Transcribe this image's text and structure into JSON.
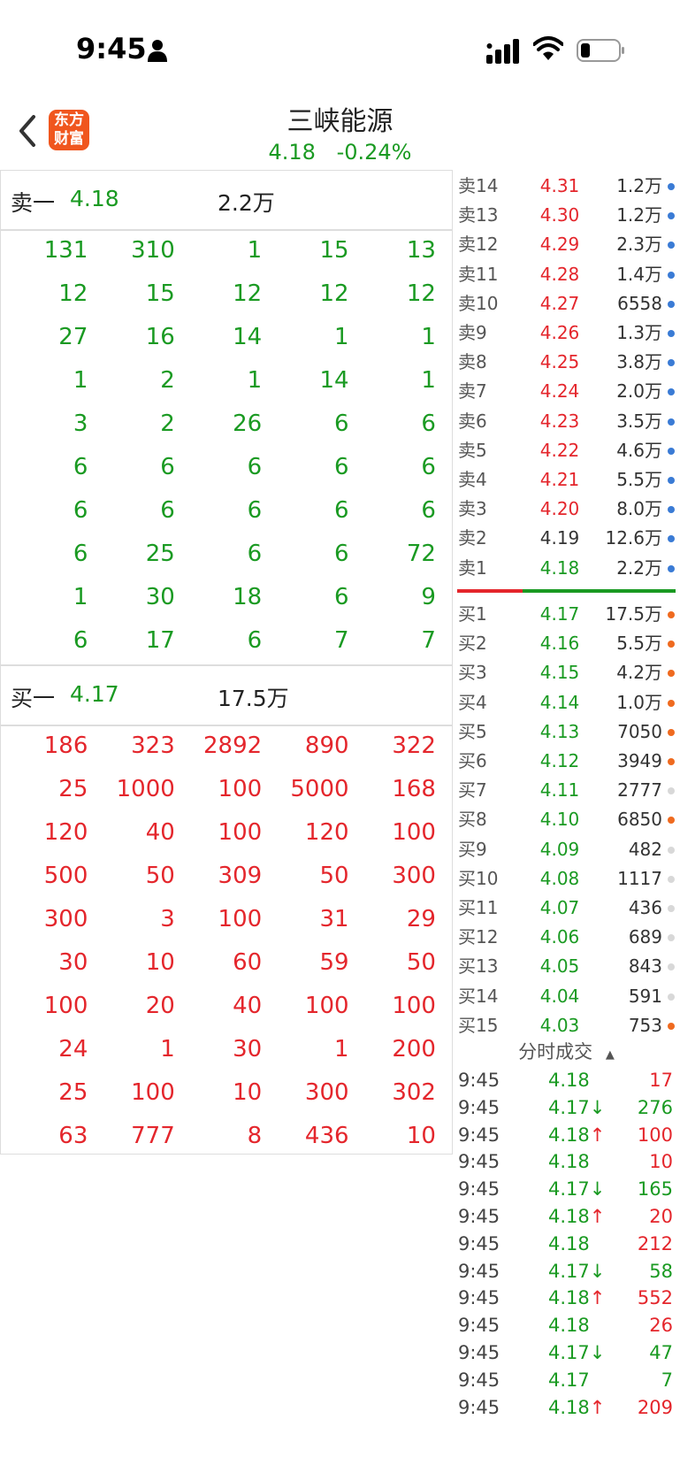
{
  "status_bar": {
    "time": "9:45"
  },
  "header": {
    "logo_line1": "东方",
    "logo_line2": "财富",
    "title": "三峡能源",
    "price": "4.18",
    "change": "-0.24%"
  },
  "sell_queue": {
    "label": "卖一",
    "price": "4.18",
    "volume": "2.2万",
    "rows": [
      [
        "131",
        "310",
        "1",
        "15",
        "13"
      ],
      [
        "12",
        "15",
        "12",
        "12",
        "12"
      ],
      [
        "27",
        "16",
        "14",
        "1",
        "1"
      ],
      [
        "1",
        "2",
        "1",
        "14",
        "1"
      ],
      [
        "3",
        "2",
        "26",
        "6",
        "6"
      ],
      [
        "6",
        "6",
        "6",
        "6",
        "6"
      ],
      [
        "6",
        "6",
        "6",
        "6",
        "6"
      ],
      [
        "6",
        "25",
        "6",
        "6",
        "72"
      ],
      [
        "1",
        "30",
        "18",
        "6",
        "9"
      ],
      [
        "6",
        "17",
        "6",
        "7",
        "7"
      ]
    ]
  },
  "buy_queue": {
    "label": "买一",
    "price": "4.17",
    "volume": "17.5万",
    "rows": [
      [
        "186",
        "323",
        "2892",
        "890",
        "322"
      ],
      [
        "25",
        "1000",
        "100",
        "5000",
        "168"
      ],
      [
        "120",
        "40",
        "100",
        "120",
        "100"
      ],
      [
        "500",
        "50",
        "309",
        "50",
        "300"
      ],
      [
        "300",
        "3",
        "100",
        "31",
        "29"
      ],
      [
        "30",
        "10",
        "60",
        "59",
        "50"
      ],
      [
        "100",
        "20",
        "40",
        "100",
        "100"
      ],
      [
        "24",
        "1",
        "30",
        "1",
        "200"
      ],
      [
        "25",
        "100",
        "10",
        "300",
        "302"
      ],
      [
        "63",
        "777",
        "8",
        "436",
        "10"
      ]
    ]
  },
  "order_book": {
    "asks": [
      {
        "label": "卖14",
        "price": "4.31",
        "volume": "1.2万",
        "color": "red"
      },
      {
        "label": "卖13",
        "price": "4.30",
        "volume": "1.2万",
        "color": "red"
      },
      {
        "label": "卖12",
        "price": "4.29",
        "volume": "2.3万",
        "color": "red"
      },
      {
        "label": "卖11",
        "price": "4.28",
        "volume": "1.4万",
        "color": "red"
      },
      {
        "label": "卖10",
        "price": "4.27",
        "volume": "6558",
        "color": "red"
      },
      {
        "label": "卖9",
        "price": "4.26",
        "volume": "1.3万",
        "color": "red"
      },
      {
        "label": "卖8",
        "price": "4.25",
        "volume": "3.8万",
        "color": "red"
      },
      {
        "label": "卖7",
        "price": "4.24",
        "volume": "2.0万",
        "color": "red"
      },
      {
        "label": "卖6",
        "price": "4.23",
        "volume": "3.5万",
        "color": "red"
      },
      {
        "label": "卖5",
        "price": "4.22",
        "volume": "4.6万",
        "color": "red"
      },
      {
        "label": "卖4",
        "price": "4.21",
        "volume": "5.5万",
        "color": "red"
      },
      {
        "label": "卖3",
        "price": "4.20",
        "volume": "8.0万",
        "color": "red"
      },
      {
        "label": "卖2",
        "price": "4.19",
        "volume": "12.6万",
        "color": "dark"
      },
      {
        "label": "卖1",
        "price": "4.18",
        "volume": "2.2万",
        "color": "green"
      }
    ],
    "bids": [
      {
        "label": "买1",
        "price": "4.17",
        "volume": "17.5万",
        "dot": "#ef6a1f"
      },
      {
        "label": "买2",
        "price": "4.16",
        "volume": "5.5万",
        "dot": "#ef6a1f"
      },
      {
        "label": "买3",
        "price": "4.15",
        "volume": "4.2万",
        "dot": "#ef6a1f"
      },
      {
        "label": "买4",
        "price": "4.14",
        "volume": "1.0万",
        "dot": "#ef6a1f"
      },
      {
        "label": "买5",
        "price": "4.13",
        "volume": "7050",
        "dot": "#ef6a1f"
      },
      {
        "label": "买6",
        "price": "4.12",
        "volume": "3949",
        "dot": "#ef6a1f"
      },
      {
        "label": "买7",
        "price": "4.11",
        "volume": "2777",
        "dot": "#d8d8d8"
      },
      {
        "label": "买8",
        "price": "4.10",
        "volume": "6850",
        "dot": "#ef6a1f"
      },
      {
        "label": "买9",
        "price": "4.09",
        "volume": "482",
        "dot": "#d8d8d8"
      },
      {
        "label": "买10",
        "price": "4.08",
        "volume": "1117",
        "dot": "#d8d8d8"
      },
      {
        "label": "买11",
        "price": "4.07",
        "volume": "436",
        "dot": "#d8d8d8"
      },
      {
        "label": "买12",
        "price": "4.06",
        "volume": "689",
        "dot": "#d8d8d8"
      },
      {
        "label": "买13",
        "price": "4.05",
        "volume": "843",
        "dot": "#d8d8d8"
      },
      {
        "label": "买14",
        "price": "4.04",
        "volume": "591",
        "dot": "#d8d8d8"
      },
      {
        "label": "买15",
        "price": "4.03",
        "volume": "753",
        "dot": "#ef6a1f"
      }
    ],
    "ask_dot_color": "#3a7bd5"
  },
  "ticks": {
    "header": "分时成交",
    "rows": [
      {
        "time": "9:45",
        "price": "4.18",
        "dir": "",
        "qty": "17",
        "qty_color": "red"
      },
      {
        "time": "9:45",
        "price": "4.17↓",
        "dir": "down",
        "qty": "276",
        "qty_color": "green"
      },
      {
        "time": "9:45",
        "price": "4.18↑",
        "dir": "up",
        "qty": "100",
        "qty_color": "red"
      },
      {
        "time": "9:45",
        "price": "4.18",
        "dir": "",
        "qty": "10",
        "qty_color": "red"
      },
      {
        "time": "9:45",
        "price": "4.17↓",
        "dir": "down",
        "qty": "165",
        "qty_color": "green"
      },
      {
        "time": "9:45",
        "price": "4.18↑",
        "dir": "up",
        "qty": "20",
        "qty_color": "red"
      },
      {
        "time": "9:45",
        "price": "4.18",
        "dir": "",
        "qty": "212",
        "qty_color": "red"
      },
      {
        "time": "9:45",
        "price": "4.17↓",
        "dir": "down",
        "qty": "58",
        "qty_color": "green"
      },
      {
        "time": "9:45",
        "price": "4.18↑",
        "dir": "up",
        "qty": "552",
        "qty_color": "red"
      },
      {
        "time": "9:45",
        "price": "4.18",
        "dir": "",
        "qty": "26",
        "qty_color": "red"
      },
      {
        "time": "9:45",
        "price": "4.17↓",
        "dir": "down",
        "qty": "47",
        "qty_color": "green"
      },
      {
        "time": "9:45",
        "price": "4.17",
        "dir": "",
        "qty": "7",
        "qty_color": "green"
      },
      {
        "time": "9:45",
        "price": "4.18↑",
        "dir": "up",
        "qty": "209",
        "qty_color": "red"
      }
    ]
  }
}
